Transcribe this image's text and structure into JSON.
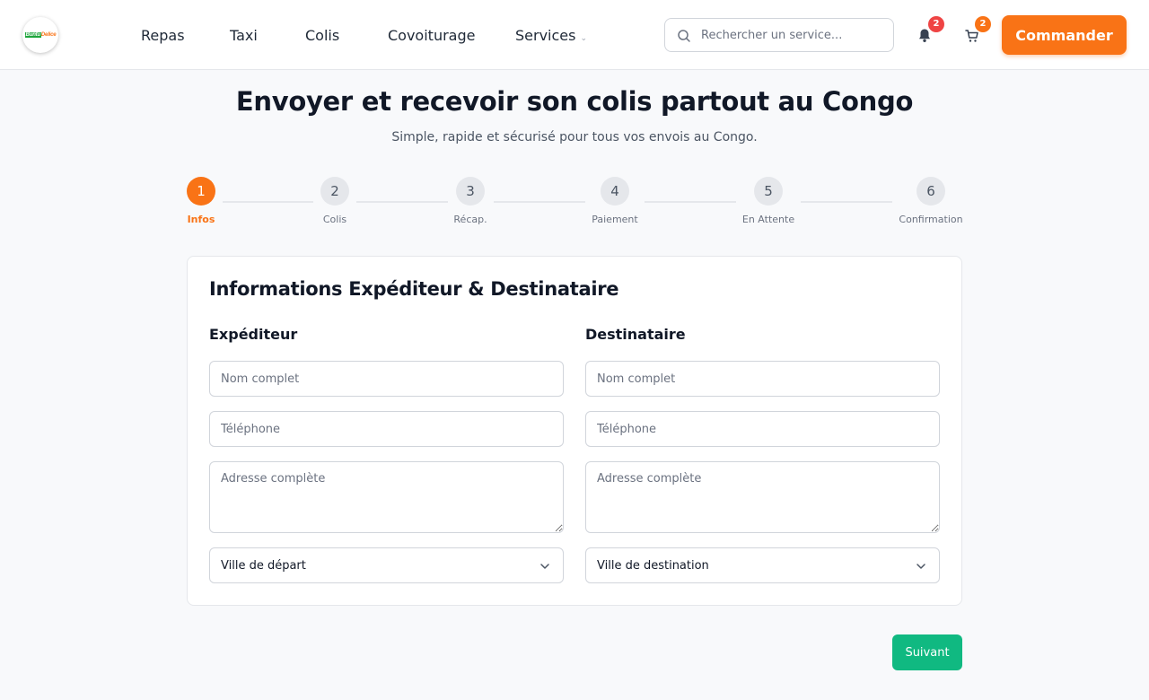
{
  "header": {
    "logo": {
      "part1": "Buntu",
      "part2": "Delice",
      "colors": {
        "green": "#1ea53c",
        "orange": "#f97316"
      }
    },
    "nav": [
      {
        "label": "Repas"
      },
      {
        "label": "Taxi"
      },
      {
        "label": "Colis"
      },
      {
        "label": "Covoiturage"
      },
      {
        "label": "Services",
        "has_dropdown": true
      }
    ],
    "search": {
      "placeholder": "Rechercher un service...",
      "value": "",
      "icon": "search-icon"
    },
    "notifications": {
      "icon": "bell-icon",
      "count": "2",
      "badge_color": "#ef4444"
    },
    "cart": {
      "icon": "cart-icon",
      "count": "2",
      "badge_color": "#f97316"
    },
    "cta_label": "Commander"
  },
  "hero": {
    "title": "Envoyer et recevoir son colis partout au Congo",
    "subtitle": "Simple, rapide et sécurisé pour tous vos envois au Congo."
  },
  "stepper": {
    "current": 1,
    "steps": [
      {
        "number": "1",
        "label": "Infos"
      },
      {
        "number": "2",
        "label": "Colis"
      },
      {
        "number": "3",
        "label": "Récap."
      },
      {
        "number": "4",
        "label": "Paiement"
      },
      {
        "number": "5",
        "label": "En Attente"
      },
      {
        "number": "6",
        "label": "Confirmation"
      }
    ]
  },
  "form": {
    "title": "Informations Expéditeur & Destinataire",
    "sender": {
      "heading": "Expéditeur",
      "name_placeholder": "Nom complet",
      "phone_placeholder": "Téléphone",
      "address_placeholder": "Adresse complète",
      "city_select": "Ville de départ"
    },
    "recipient": {
      "heading": "Destinataire",
      "name_placeholder": "Nom complet",
      "phone_placeholder": "Téléphone",
      "address_placeholder": "Adresse complète",
      "city_select": "Ville de destination"
    },
    "next_label": "Suivant"
  },
  "colors": {
    "accent": "#f97316",
    "success": "#10b981"
  }
}
